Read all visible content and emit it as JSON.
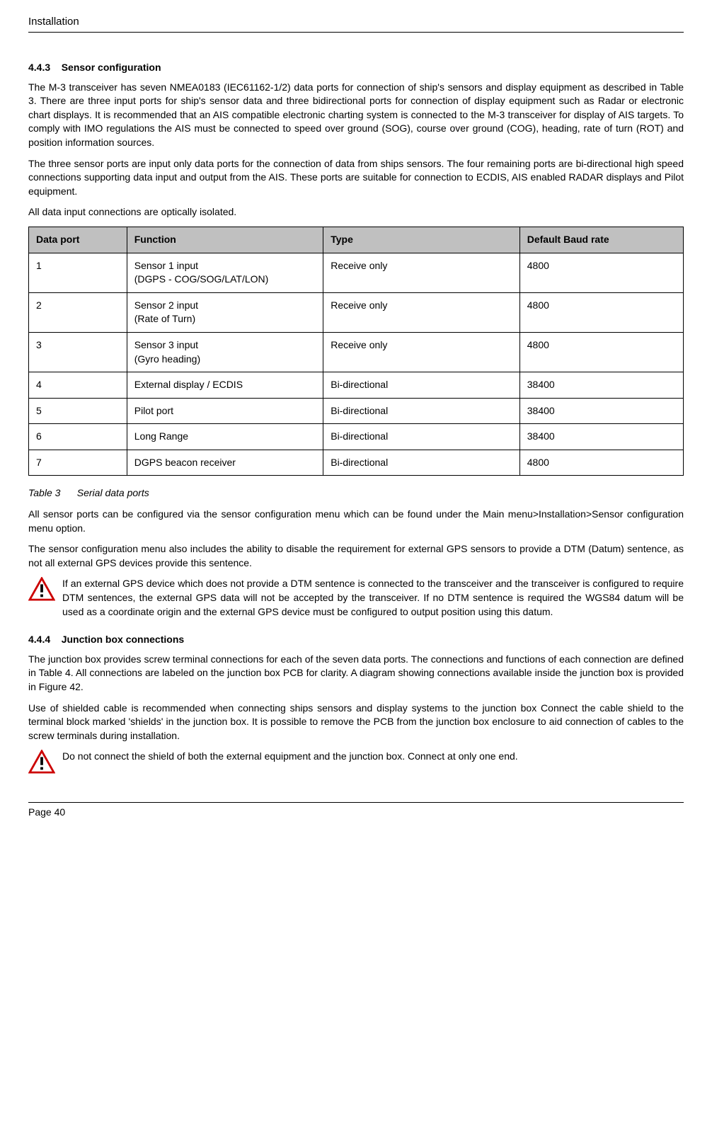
{
  "header": {
    "title": "Installation"
  },
  "section1": {
    "number": "4.4.3",
    "title": "Sensor configuration",
    "para1": "The M-3 transceiver has seven NMEA0183 (IEC61162-1/2) data ports for connection of ship's sensors and display equipment as described in Table 3. There are three input ports for ship's sensor data and three bidirectional ports for connection of display equipment such as Radar or electronic chart displays. It is recommended that an AIS compatible electronic charting system is connected to the M-3 transceiver for display of AIS targets. To comply with IMO regulations the AIS must be connected to speed over ground (SOG), course over ground (COG), heading, rate of turn (ROT) and position information sources.",
    "para2": "The three sensor ports are input only data ports for the connection of data from ships sensors. The four remaining ports are bi-directional high speed connections supporting data input and output from the AIS. These ports are suitable for connection to ECDIS, AIS enabled RADAR displays and Pilot equipment.",
    "para3": "All data input connections are optically isolated."
  },
  "table": {
    "headers": {
      "h1": "Data port",
      "h2": "Function",
      "h3": "Type",
      "h4": "Default Baud rate"
    },
    "rows": [
      {
        "c1": "1",
        "c2": "Sensor 1 input\n(DGPS - COG/SOG/LAT/LON)",
        "c3": "Receive only",
        "c4": "4800"
      },
      {
        "c1": "2",
        "c2": "Sensor 2 input\n(Rate of Turn)",
        "c3": "Receive only",
        "c4": "4800"
      },
      {
        "c1": "3",
        "c2": "Sensor 3 input\n(Gyro heading)",
        "c3": "Receive only",
        "c4": "4800"
      },
      {
        "c1": "4",
        "c2": "External display / ECDIS",
        "c3": "Bi-directional",
        "c4": "38400"
      },
      {
        "c1": "5",
        "c2": "Pilot port",
        "c3": "Bi-directional",
        "c4": "38400"
      },
      {
        "c1": "6",
        "c2": "Long Range",
        "c3": "Bi-directional",
        "c4": "38400"
      },
      {
        "c1": "7",
        "c2": "DGPS beacon receiver",
        "c3": "Bi-directional",
        "c4": "4800"
      }
    ],
    "caption_label": "Table 3",
    "caption_text": "Serial data ports"
  },
  "after_table": {
    "para1": "All sensor ports can be configured via the sensor configuration menu which can be found under the Main menu>Installation>Sensor configuration menu option.",
    "para2": "The sensor configuration menu also includes the ability to disable the requirement for external GPS sensors to provide a DTM (Datum) sentence, as not all external GPS devices provide this sentence."
  },
  "warning1": {
    "text": "If an external GPS device which does not provide a DTM sentence is connected to the transceiver and the transceiver is configured to require DTM sentences, the external GPS data will not be accepted by the transceiver. If no DTM sentence is required the WGS84 datum will be used as a coordinate origin and the external GPS device must be configured to output position using this datum."
  },
  "section2": {
    "number": "4.4.4",
    "title": "Junction box connections",
    "para1": "The junction box provides screw terminal connections for each of the seven data ports. The connections and functions of each connection are defined in Table 4. All connections are labeled on the junction box PCB for clarity. A diagram showing connections available inside the junction box is provided in Figure 42.",
    "para2": "Use of shielded cable is recommended when connecting ships sensors and display systems to the junction box Connect the cable shield to the terminal block marked 'shields' in the junction box. It is possible to remove the PCB from the junction box enclosure to aid connection of cables to the screw terminals during installation."
  },
  "warning2": {
    "text": "Do not connect the shield of both the external equipment and the junction box. Connect at only one end."
  },
  "footer": {
    "page": "Page 40"
  }
}
